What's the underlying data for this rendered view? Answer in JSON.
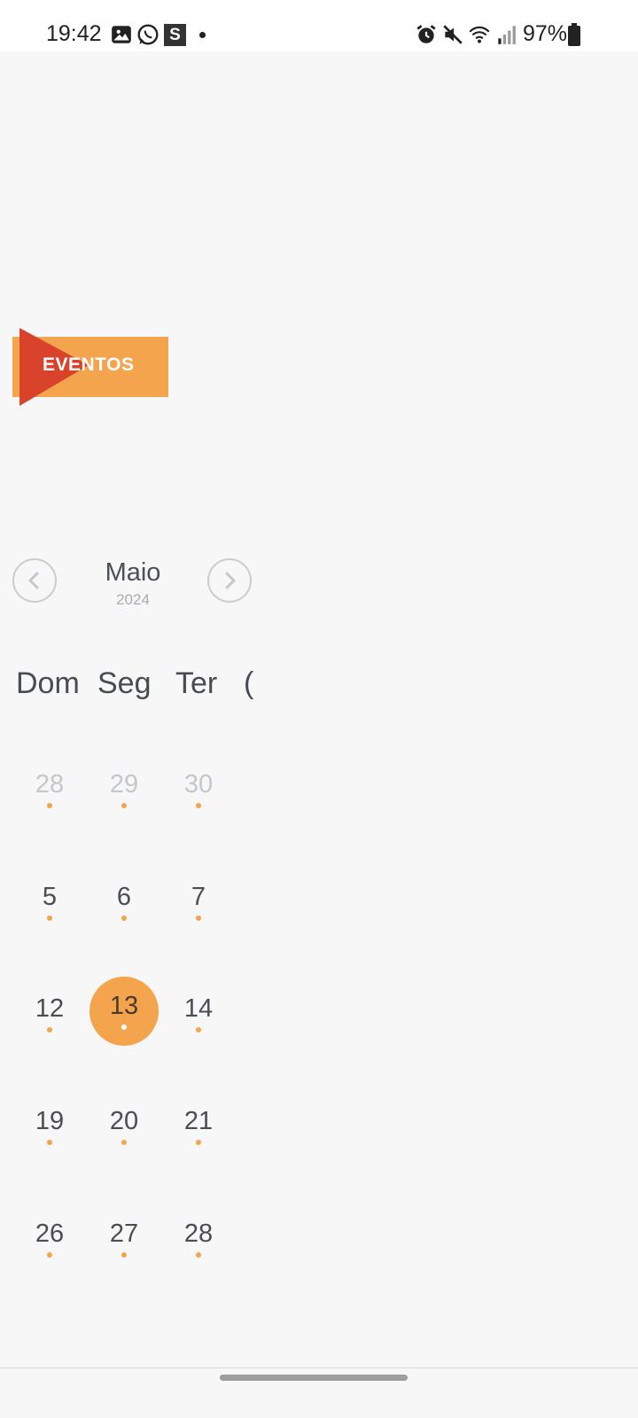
{
  "status_bar": {
    "time": "19:42",
    "battery": "97%",
    "left_icons": [
      "gallery-icon",
      "whatsapp-icon",
      "s-app-icon",
      "notification-dot"
    ],
    "right_icons": [
      "alarm-icon",
      "mute-icon",
      "wifi-icon",
      "signal-icon",
      "battery-icon"
    ],
    "s_badge": "S"
  },
  "banner": {
    "label": "EVENTOS",
    "colors": {
      "bar": "#f4a44c",
      "arrow": "#d9432b"
    }
  },
  "calendar": {
    "month": "Maio",
    "year": "2024",
    "weekdays": [
      "Dom",
      "Seg",
      "Ter",
      "("
    ],
    "weeks": [
      [
        {
          "day": "28",
          "muted": true
        },
        {
          "day": "29",
          "muted": true
        },
        {
          "day": "30",
          "muted": true
        }
      ],
      [
        {
          "day": "5"
        },
        {
          "day": "6"
        },
        {
          "day": "7"
        }
      ],
      [
        {
          "day": "12"
        },
        {
          "day": "13",
          "selected": true
        },
        {
          "day": "14"
        }
      ],
      [
        {
          "day": "19"
        },
        {
          "day": "20"
        },
        {
          "day": "21"
        }
      ],
      [
        {
          "day": "26"
        },
        {
          "day": "27"
        },
        {
          "day": "28"
        }
      ]
    ],
    "accent": "#f4a44c"
  }
}
